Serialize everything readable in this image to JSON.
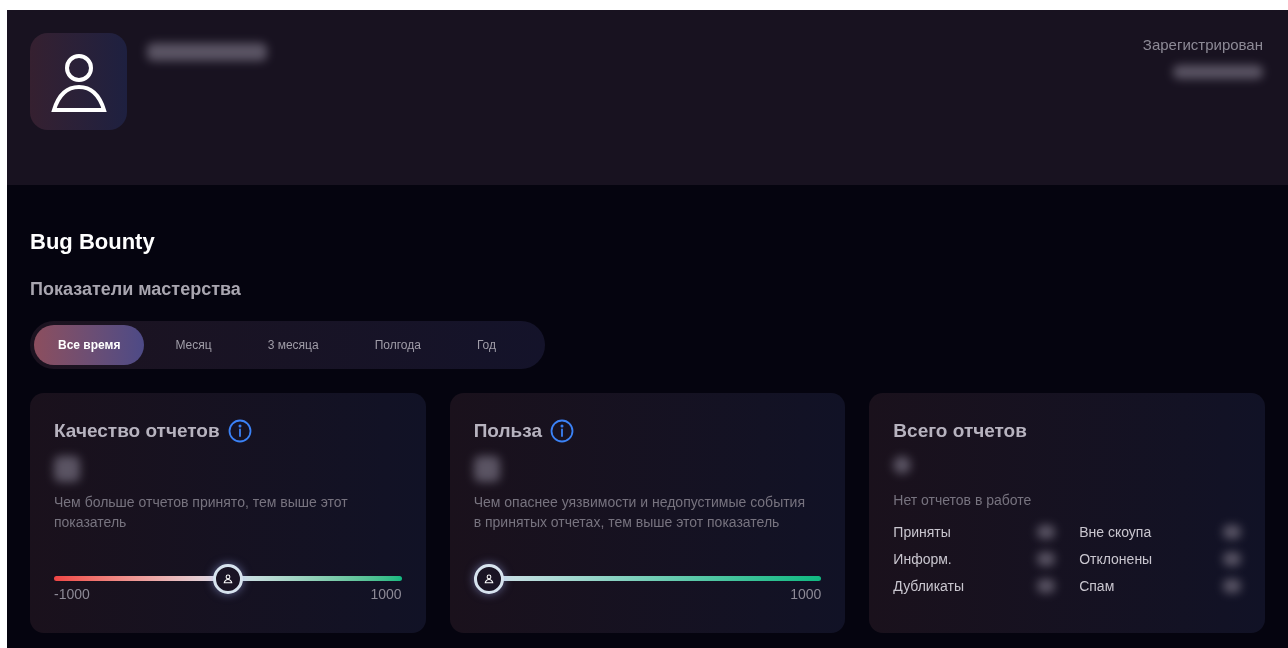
{
  "profile": {
    "registered_label": "Зарегистрирован"
  },
  "section_title": "Bug Bounty",
  "subtitle": "Показатели мастерства",
  "periods": [
    {
      "label": "Все время",
      "selected": true
    },
    {
      "label": "Месяц",
      "selected": false
    },
    {
      "label": "3 месяца",
      "selected": false
    },
    {
      "label": "Полгода",
      "selected": false
    },
    {
      "label": "Год",
      "selected": false
    }
  ],
  "cards": [
    {
      "kind": "slider",
      "title": "Качество отчетов",
      "info": true,
      "description": "Чем больше отчетов принято, тем выше этот показатель",
      "level": 0.5,
      "min_label": "-1000",
      "max_label": "1000"
    },
    {
      "kind": "slider",
      "title": "Польза",
      "info": true,
      "description": "Чем опаснее уязвимости и недопустимые события в принятых отчетах, тем выше этот показатель",
      "level": 0,
      "max_label": "1000"
    },
    {
      "kind": "totals",
      "title": "Всего отчетов",
      "info": false,
      "note": "Нет отчетов в работе",
      "stats": [
        "Приняты",
        "Вне скоупа",
        "Информ.",
        "Отклонены",
        "Дубликаты",
        "Спам"
      ]
    }
  ]
}
